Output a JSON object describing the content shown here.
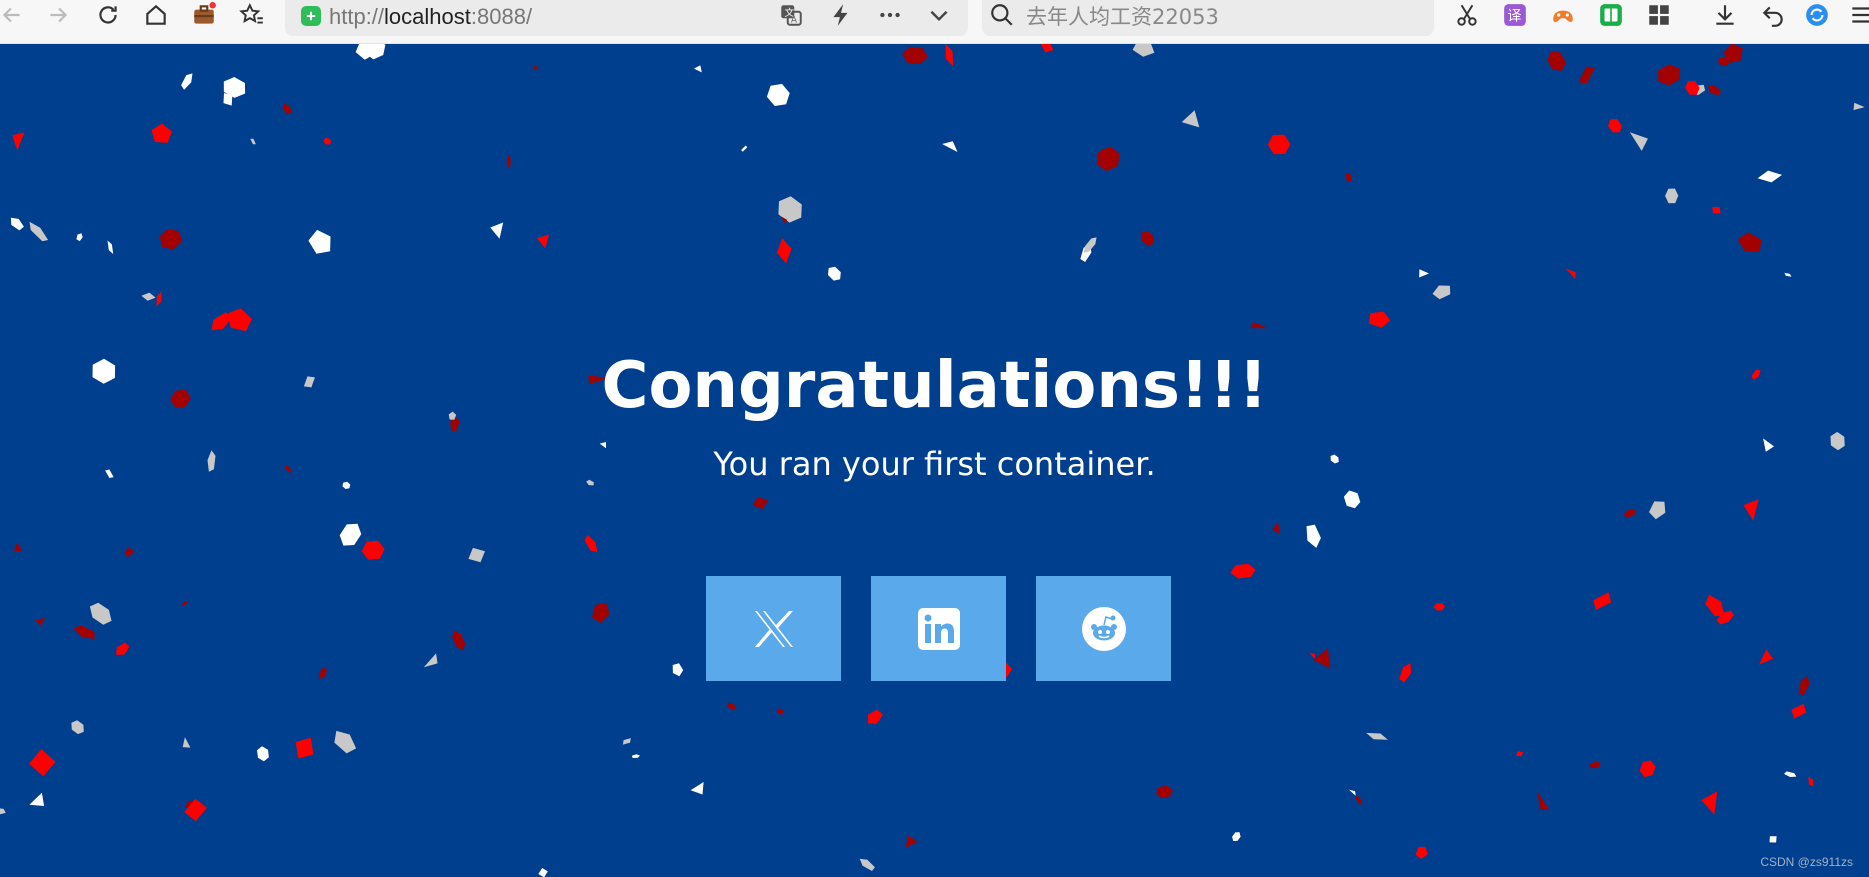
{
  "browser": {
    "url_prefix": "http://",
    "url_host": "localhost",
    "url_suffix": ":8088/",
    "search_placeholder": "去年人均工资22053",
    "toolbar_icons": [
      "back-icon",
      "forward-icon",
      "reload-icon",
      "home-icon",
      "briefcase-icon",
      "favorites-icon",
      "translate-icon",
      "lightning-icon",
      "more-icon",
      "chevron-down-icon",
      "search-icon",
      "scissors-icon",
      "translate-app-icon",
      "game-icon",
      "reader-icon",
      "apps-grid-icon",
      "download-icon",
      "undo-icon",
      "sync-icon",
      "menu-icon"
    ]
  },
  "page": {
    "headline": "Congratulations!!!",
    "subheadline": "You ran your first container.",
    "share_buttons": [
      "x-icon",
      "linkedin-icon",
      "reddit-icon"
    ],
    "background_color": "#003f8e",
    "button_color": "#5aa9ea",
    "confetti_colors": [
      "#ffffff",
      "#c8c8c8",
      "#ff0000",
      "#a30000"
    ]
  },
  "watermark": "CSDN @zs911zs"
}
